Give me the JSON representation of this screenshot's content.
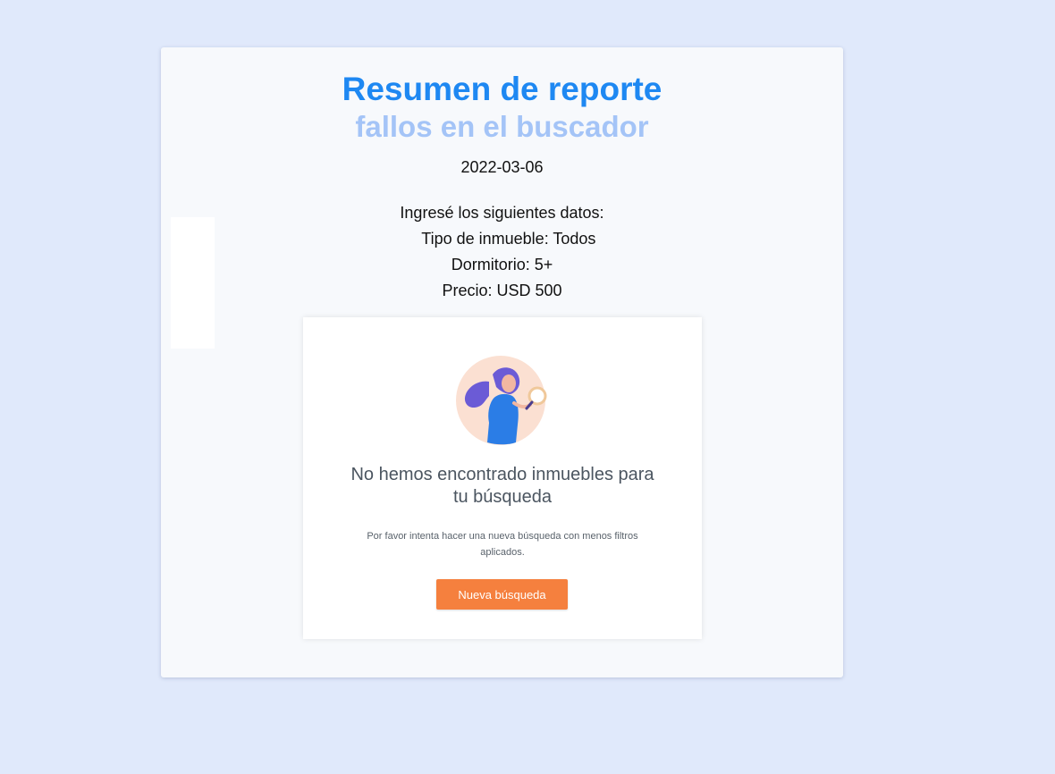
{
  "report": {
    "title": "Resumen de reporte",
    "subtitle": "fallos en el buscador",
    "date": "2022-03-06",
    "intro": "Ingresé los siguientes datos:",
    "fields": [
      "   Tipo de inmueble: Todos",
      "Dormitorio: 5+",
      "Precio: USD 500"
    ]
  },
  "screenshot": {
    "heading_line1": "No hemos encontrado inmuebles para",
    "heading_line2": "tu búsqueda",
    "description_line1": "Por favor intenta hacer una nueva búsqueda con menos filtros",
    "description_line2": "aplicados.",
    "button_label": "Nueva búsqueda",
    "illustration": "woman-with-magnifier-illustration"
  },
  "colors": {
    "page_background": "#e0e9fb",
    "title": "#1e88f2",
    "subtitle": "#a4c4f7",
    "button": "#f5803e"
  }
}
